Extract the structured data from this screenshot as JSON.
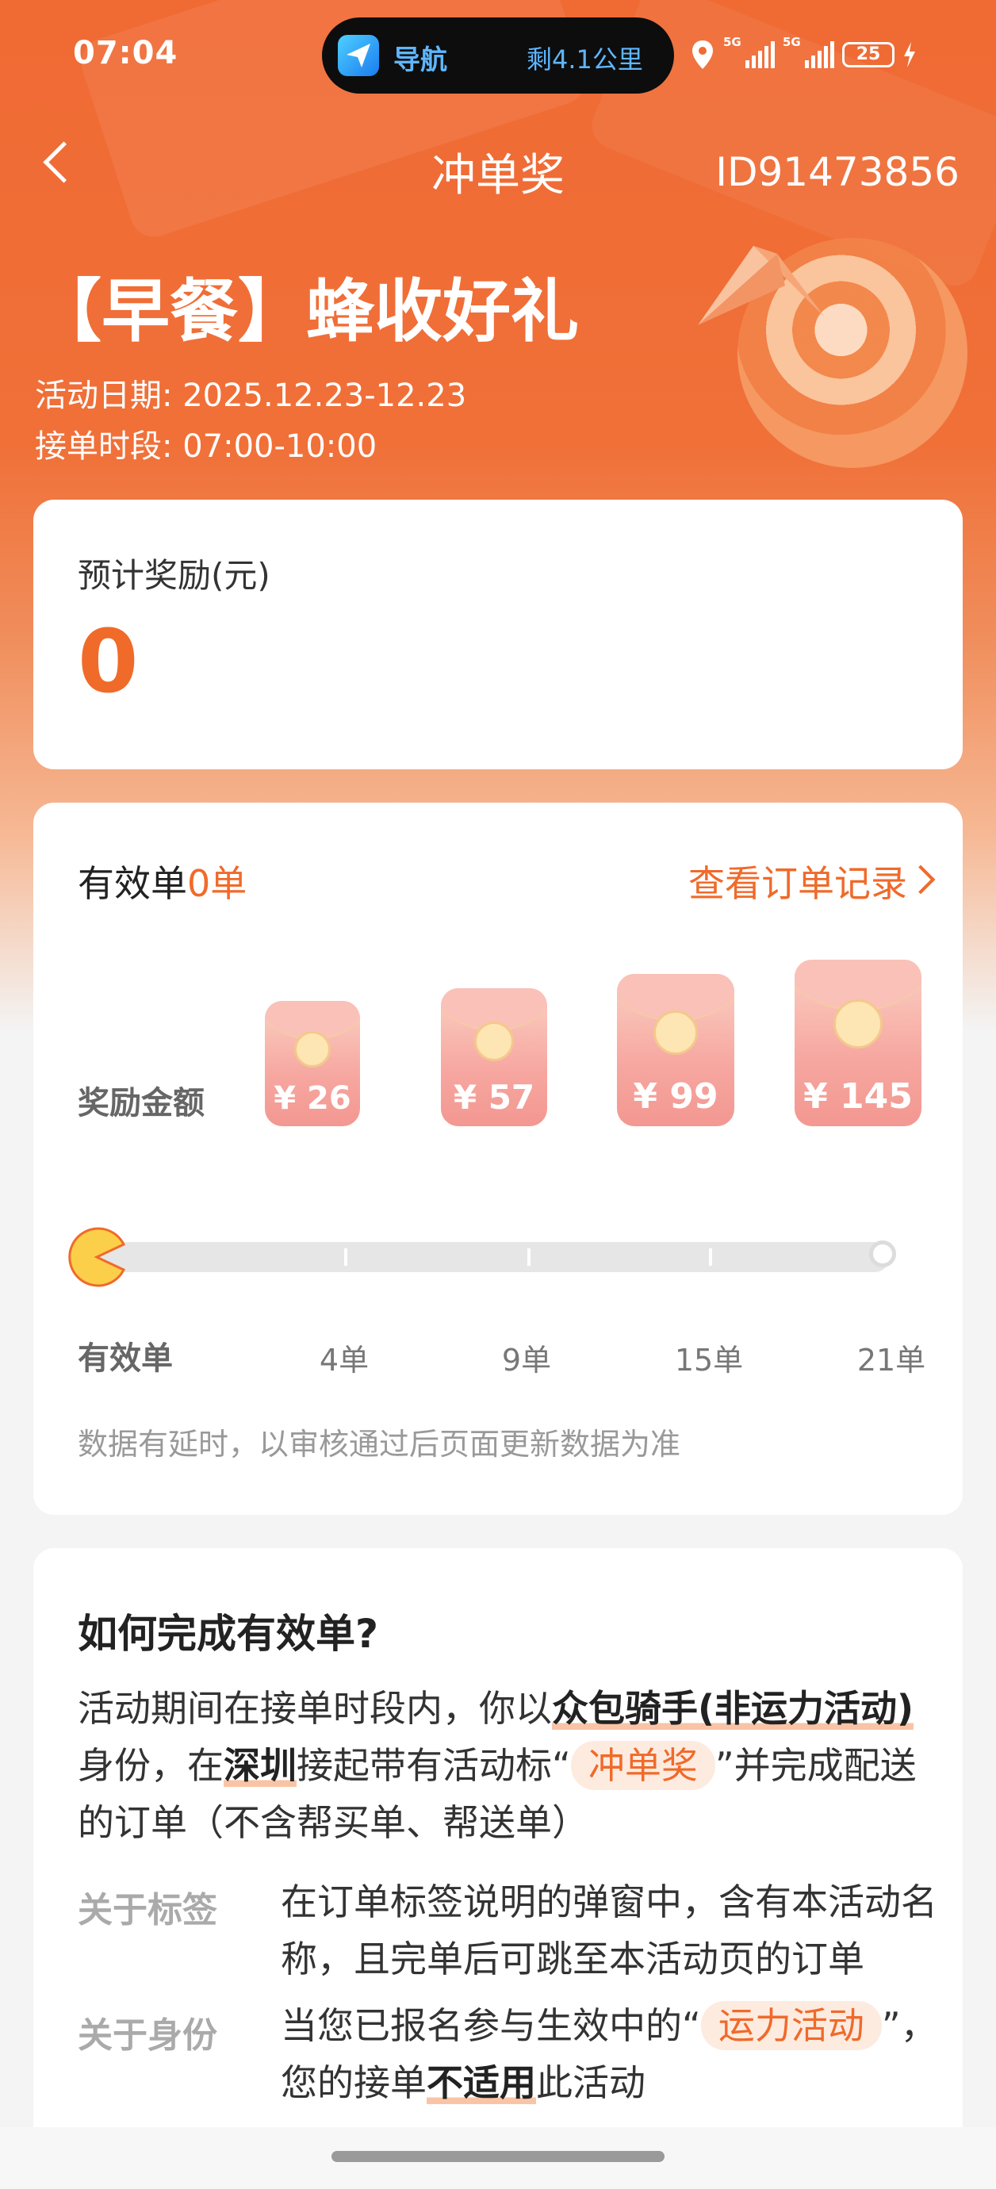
{
  "status_bar": {
    "time": "07:04",
    "nav_label": "导航",
    "distance": "剩4.1公里",
    "net1": "5G",
    "net2": "5G",
    "battery": "25"
  },
  "header": {
    "title": "冲单奖",
    "activity_id": "ID91473856"
  },
  "promo": {
    "title": "【早餐】蜂收好礼",
    "date": "活动日期: 2025.12.23-12.23",
    "hours": "接单时段: 07:00-10:00"
  },
  "reward": {
    "label": "预计奖励(元)",
    "value": "0"
  },
  "progress": {
    "valid_prefix": "有效单",
    "valid_count": "0单",
    "record_link": "查看订单记录",
    "reward_row_label": "奖励金额",
    "tiers": [
      {
        "amount": "¥ 26",
        "orders": "4单"
      },
      {
        "amount": "¥ 57",
        "orders": "9单"
      },
      {
        "amount": "¥ 99",
        "orders": "15单"
      },
      {
        "amount": "¥ 145",
        "orders": "21单"
      }
    ],
    "orders_row_label": "有效单",
    "current_progress": 0,
    "note": "数据有延时，以审核通过后页面更新数据为准"
  },
  "howto": {
    "title": "如何完成有效单?",
    "p1": {
      "a": "活动期间在接单时段内，你以",
      "b": "众包骑手(非运力活动)",
      "c": "身份，在",
      "d": "深圳",
      "e": "接起带有活动标“",
      "tag": "冲单奖",
      "f": "”并完成配送的订单（不含帮买单、帮送单）"
    },
    "tag_key": "关于标签",
    "tag_val": "在订单标签说明的弹窗中，含有本活动名称，且完单后可跳至本活动页的订单",
    "id_key": "关于身份",
    "id_val": {
      "a": "当您已报名参与生效中的“",
      "tag": "运力活动",
      "b": "”，您的接单",
      "c": "不适用",
      "d": "此活动"
    }
  },
  "colors": {
    "accent": "#f06a2a",
    "hero": "#f06a34"
  }
}
